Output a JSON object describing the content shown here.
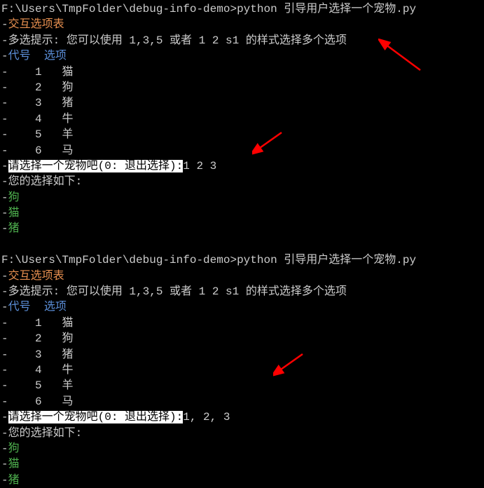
{
  "session1": {
    "prompt_path": "F:\\Users\\TmpFolder\\debug-info-demo>",
    "command": "python 引导用户选择一个宠物.py",
    "header_title": "交互选项表",
    "hint_label": "多选提示: ",
    "hint_text": "您可以使用 1,3,5 或者 1 2 s1 的样式选择多个选项",
    "col_id": "代号",
    "col_option": "选项",
    "rows": [
      {
        "id": "1",
        "name": "猫"
      },
      {
        "id": "2",
        "name": "狗"
      },
      {
        "id": "3",
        "name": "猪"
      },
      {
        "id": "4",
        "name": "牛"
      },
      {
        "id": "5",
        "name": "羊"
      },
      {
        "id": "6",
        "name": "马"
      }
    ],
    "input_prompt": "请选择一个宠物吧(0: 退出选择):",
    "input_value": "1 2 3",
    "result_label": "您的选择如下:",
    "results": [
      "狗",
      "猫",
      "猪"
    ]
  },
  "session2": {
    "prompt_path": "F:\\Users\\TmpFolder\\debug-info-demo>",
    "command": "python 引导用户选择一个宠物.py",
    "header_title": "交互选项表",
    "hint_label": "多选提示: ",
    "hint_text": "您可以使用 1,3,5 或者 1 2 s1 的样式选择多个选项",
    "col_id": "代号",
    "col_option": "选项",
    "rows": [
      {
        "id": "1",
        "name": "猫"
      },
      {
        "id": "2",
        "name": "狗"
      },
      {
        "id": "3",
        "name": "猪"
      },
      {
        "id": "4",
        "name": "牛"
      },
      {
        "id": "5",
        "name": "羊"
      },
      {
        "id": "6",
        "name": "马"
      }
    ],
    "input_prompt": "请选择一个宠物吧(0: 退出选择):",
    "input_value": "1, 2, 3",
    "result_label": "您的选择如下:",
    "results": [
      "狗",
      "猫",
      "猪"
    ]
  },
  "dashes": {
    "d1": "-",
    "d2": "- ",
    "d4": "-    ",
    "dsp": "-  "
  }
}
